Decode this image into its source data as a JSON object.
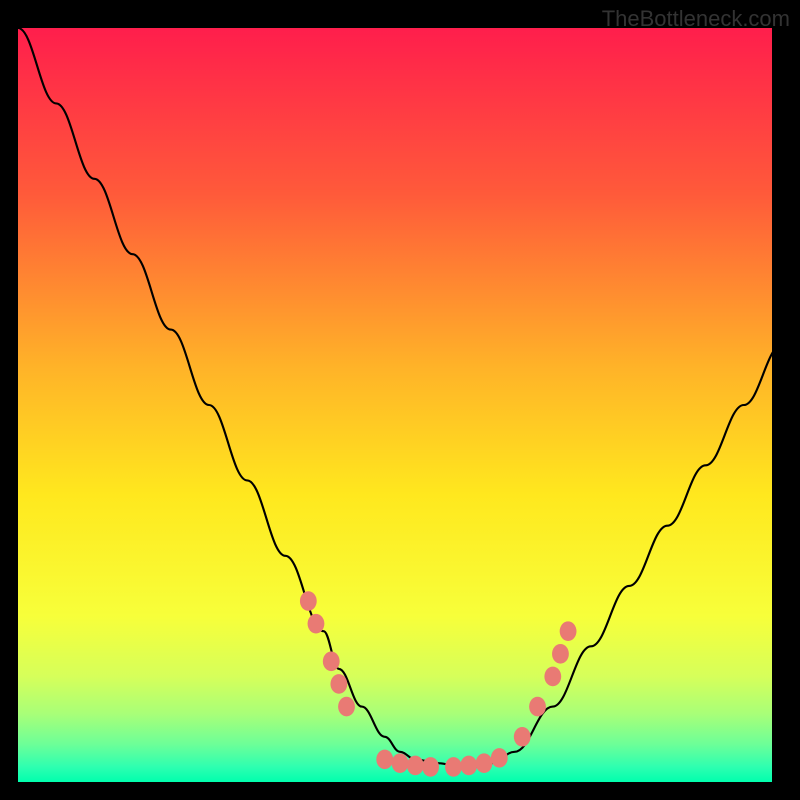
{
  "watermark": "TheBottleneck.com",
  "chart_data": {
    "type": "line",
    "title": "",
    "xlabel": "",
    "ylabel": "",
    "xlim": [
      0,
      100
    ],
    "ylim": [
      0,
      100
    ],
    "series": [
      {
        "name": "bottleneck-curve",
        "x": [
          0,
          5,
          10,
          15,
          20,
          25,
          30,
          35,
          40,
          42,
          45,
          48,
          50,
          52,
          55,
          58,
          60,
          62,
          65,
          70,
          75,
          80,
          85,
          90,
          95,
          100
        ],
        "values": [
          100,
          90,
          80,
          70,
          60,
          50,
          40,
          30,
          20,
          15,
          10,
          6,
          4,
          3,
          2.5,
          2,
          2,
          2.5,
          4,
          10,
          18,
          26,
          34,
          42,
          50,
          58
        ]
      }
    ],
    "dots": [
      {
        "x": 38,
        "y": 24
      },
      {
        "x": 39,
        "y": 21
      },
      {
        "x": 41,
        "y": 16
      },
      {
        "x": 42,
        "y": 13
      },
      {
        "x": 43,
        "y": 10
      },
      {
        "x": 48,
        "y": 3
      },
      {
        "x": 50,
        "y": 2.5
      },
      {
        "x": 52,
        "y": 2.2
      },
      {
        "x": 54,
        "y": 2
      },
      {
        "x": 57,
        "y": 2
      },
      {
        "x": 59,
        "y": 2.2
      },
      {
        "x": 61,
        "y": 2.5
      },
      {
        "x": 63,
        "y": 3.2
      },
      {
        "x": 66,
        "y": 6
      },
      {
        "x": 68,
        "y": 10
      },
      {
        "x": 70,
        "y": 14
      },
      {
        "x": 71,
        "y": 17
      },
      {
        "x": 72,
        "y": 20
      }
    ],
    "gradient_stops": [
      {
        "pct": 0,
        "color": "#ff1e4c"
      },
      {
        "pct": 22,
        "color": "#ff5a3a"
      },
      {
        "pct": 45,
        "color": "#ffb328"
      },
      {
        "pct": 62,
        "color": "#ffe81e"
      },
      {
        "pct": 78,
        "color": "#f7ff3a"
      },
      {
        "pct": 86,
        "color": "#d6ff5a"
      },
      {
        "pct": 91,
        "color": "#a8ff78"
      },
      {
        "pct": 95,
        "color": "#6cff98"
      },
      {
        "pct": 98,
        "color": "#2effb0"
      },
      {
        "pct": 100,
        "color": "#00ffae"
      }
    ]
  }
}
